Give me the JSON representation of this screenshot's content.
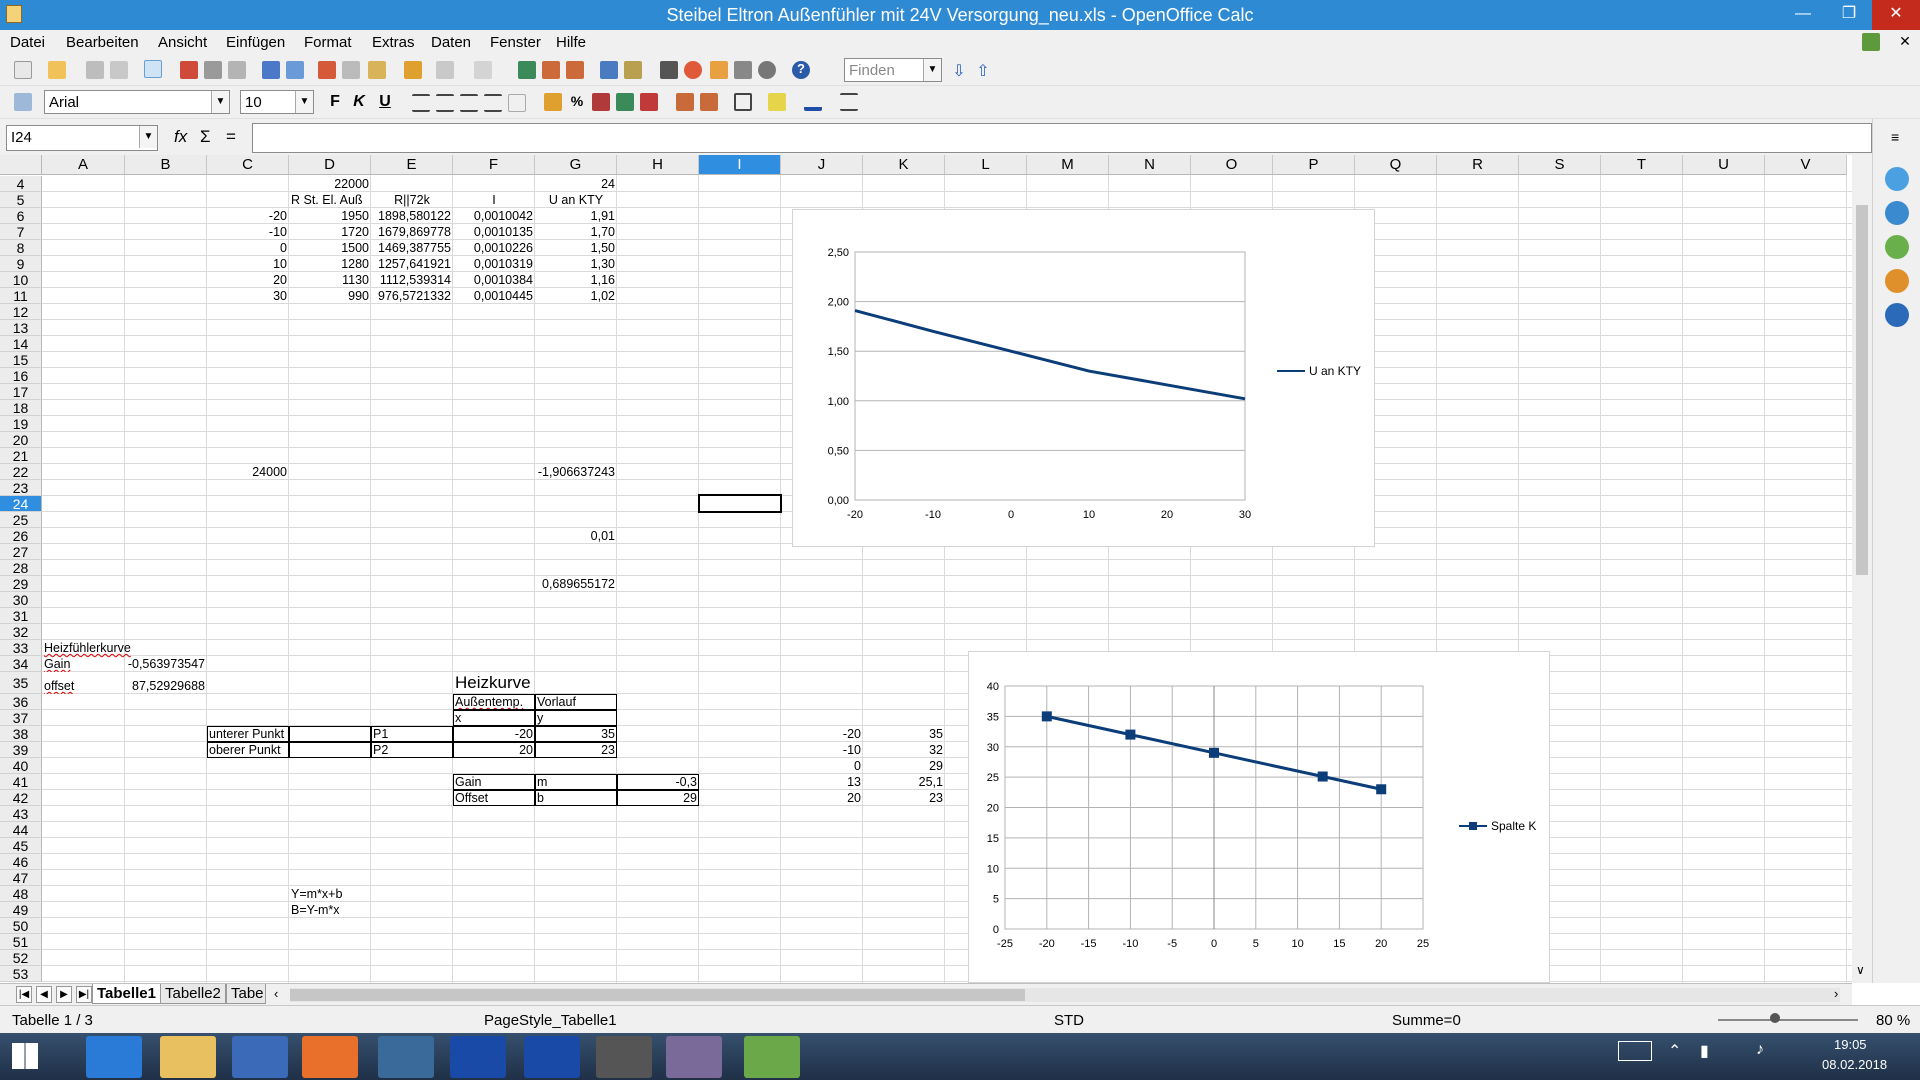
{
  "window": {
    "title": "Steibel Eltron Außenfühler mit 24V Versorgung_neu.xls - OpenOffice Calc",
    "minimize": "—",
    "maximize": "❐",
    "close": "✕"
  },
  "menu": [
    "Datei",
    "Bearbeiten",
    "Ansicht",
    "Einfügen",
    "Format",
    "Extras",
    "Daten",
    "Fenster",
    "Hilfe"
  ],
  "toolbar": {
    "find_placeholder": "Finden"
  },
  "format": {
    "font_name": "Arial",
    "font_size": "10",
    "bold": "F",
    "italic": "K",
    "underline": "U",
    "percent": "%"
  },
  "formula_bar": {
    "name_box": "I24",
    "function_wizard": "fx",
    "sum": "Σ",
    "equals": "=",
    "value": ""
  },
  "columns": [
    "A",
    "B",
    "C",
    "D",
    "E",
    "F",
    "G",
    "H",
    "I",
    "J",
    "K",
    "L",
    "M",
    "N",
    "O",
    "P",
    "Q",
    "R",
    "S",
    "T",
    "U",
    "V"
  ],
  "selected_column": "I",
  "rows": [
    "4",
    "5",
    "6",
    "7",
    "8",
    "9",
    "10",
    "11",
    "12",
    "13",
    "14",
    "15",
    "16",
    "17",
    "18",
    "19",
    "20",
    "21",
    "22",
    "23",
    "24",
    "25",
    "26",
    "27",
    "28",
    "29",
    "30",
    "31",
    "32",
    "33",
    "34",
    "35",
    "36",
    "37",
    "38",
    "39",
    "40",
    "41",
    "42",
    "43",
    "44",
    "45",
    "46",
    "47",
    "48",
    "49",
    "50",
    "51",
    "52",
    "53"
  ],
  "selected_row": "24",
  "cells": {
    "D4": "22000",
    "G4": "24",
    "D5": "R St. El. Auß",
    "E5": "R||72k",
    "F5": "I",
    "G5": "U an KTY",
    "C6": "-20",
    "D6": "1950",
    "E6": "1898,580122",
    "F6": "0,0010042",
    "G6": "1,91",
    "C7": "-10",
    "D7": "1720",
    "E7": "1679,869778",
    "F7": "0,0010135",
    "G7": "1,70",
    "C8": "0",
    "D8": "1500",
    "E8": "1469,387755",
    "F8": "0,0010226",
    "G8": "1,50",
    "C9": "10",
    "D9": "1280",
    "E9": "1257,641921",
    "F9": "0,0010319",
    "G9": "1,30",
    "C10": "20",
    "D10": "1130",
    "E10": "1112,539314",
    "F10": "0,0010384",
    "G10": "1,16",
    "C11": "30",
    "D11": "990",
    "E11": "976,5721332",
    "F11": "0,0010445",
    "G11": "1,02",
    "C22": "24000",
    "G22": "-1,906637243",
    "G26": "0,01",
    "G29": "0,689655172",
    "A33": "Heizfühlerkurve",
    "A34": "Gain",
    "B34": "-0,563973547",
    "A35": "offset",
    "B35": "87,52929688",
    "F35": "Heizkurve",
    "F36": "Außentemp.",
    "G36": "Vorlauf",
    "F37": "x",
    "G37": "y",
    "C38": "unterer Punkt",
    "E38": "P1",
    "F38": "-20",
    "G38": "35",
    "J38": "-20",
    "K38": "35",
    "C39": "oberer Punkt",
    "E39": "P2",
    "F39": "20",
    "G39": "23",
    "J39": "-10",
    "K39": "32",
    "J40": "0",
    "K40": "29",
    "F41": "Gain",
    "G41": "m",
    "H41": "-0,3",
    "J41": "13",
    "K41": "25,1",
    "F42": "Offset",
    "G42": "b",
    "H42": "29",
    "J42": "20",
    "K42": "23",
    "D48": "Y=m*x+b",
    "D49": "B=Y-m*x"
  },
  "chart_data": [
    {
      "type": "line",
      "x": [
        -20,
        -10,
        0,
        10,
        20,
        30
      ],
      "series": [
        {
          "name": "U an KTY",
          "values": [
            1.91,
            1.7,
            1.5,
            1.3,
            1.16,
            1.02
          ],
          "color": "#0b3d78"
        }
      ],
      "xticks": [
        "-20",
        "-10",
        "0",
        "10",
        "20",
        "30"
      ],
      "yticks": [
        "0,00",
        "0,50",
        "1,00",
        "1,50",
        "2,00",
        "2,50"
      ],
      "ylim": [
        0,
        2.5
      ],
      "xlim": [
        -20,
        30
      ],
      "grid": "horizontal",
      "legend": "right"
    },
    {
      "type": "scatter",
      "x": [
        -20,
        -10,
        0,
        13,
        20
      ],
      "series": [
        {
          "name": "Spalte K",
          "values": [
            35,
            32,
            29,
            25.1,
            23
          ],
          "color": "#0b3d78"
        }
      ],
      "xticks": [
        "-25",
        "-20",
        "-15",
        "-10",
        "-5",
        "0",
        "5",
        "10",
        "15",
        "20",
        "25"
      ],
      "yticks": [
        "0",
        "5",
        "10",
        "15",
        "20",
        "25",
        "30",
        "35",
        "40"
      ],
      "xlim": [
        -25,
        25
      ],
      "ylim": [
        0,
        40
      ],
      "grid": "both",
      "legend": "right"
    }
  ],
  "sheet_tabs": [
    "Tabelle1",
    "Tabelle2",
    "Tabe"
  ],
  "active_tab": "Tabelle1",
  "status": {
    "sheet": "Tabelle 1 / 3",
    "page_style": "PageStyle_Tabelle1",
    "mode": "STD",
    "sum": "Summe=0",
    "zoom": "80 %"
  },
  "taskbar": {
    "time": "19:05",
    "date": "08.02.2018"
  }
}
